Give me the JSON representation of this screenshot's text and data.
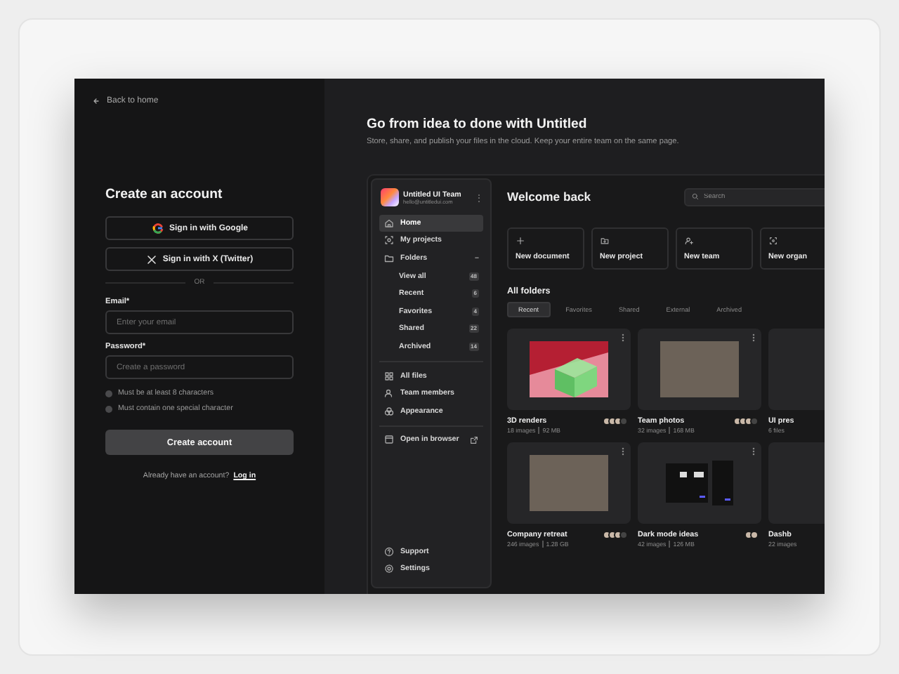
{
  "auth": {
    "back_link": "Back to home",
    "title": "Create an account",
    "social_buttons": [
      {
        "kind": "google",
        "label": "Sign in with Google"
      },
      {
        "kind": "x",
        "label": "Sign in with X (Twitter)"
      }
    ],
    "divider": "OR",
    "fields": [
      {
        "label": "Email*",
        "placeholder": "Enter your email"
      },
      {
        "label": "Password*",
        "placeholder": "Create a password"
      }
    ],
    "password_rules": [
      {
        "text": "Must be at least 8 characters",
        "checked": false
      },
      {
        "text": "Must contain one special character",
        "checked": false
      }
    ],
    "submit": "Create account",
    "footer": "Already have an account?",
    "login_link": "Log in"
  },
  "promo": {
    "title": "Go from idea to done with Untitled",
    "subtitle": "Store, share, and publish your files in the cloud. Keep your entire team on the same page."
  },
  "sidebar": {
    "team_name": "Untitled UI Team",
    "team_email": "hello@untitledui.com",
    "menu": "⋮",
    "groups": [
      [
        {
          "kind": "home",
          "label": "Home",
          "selected": true
        },
        {
          "kind": "projects",
          "label": "My projects",
          "selected": false
        },
        {
          "kind": "folder",
          "label": "Folders",
          "selected": false,
          "expanded": true,
          "toggle": "–",
          "children": [
            {
              "label": "View all",
              "count": "48",
              "selected": false
            },
            {
              "label": "Recent",
              "count": "6",
              "selected": false
            },
            {
              "label": "Favorites",
              "count": "4",
              "selected": false
            },
            {
              "label": "Shared",
              "count": "22",
              "selected": false
            },
            {
              "label": "Archived",
              "count": "14",
              "selected": false
            }
          ]
        }
      ],
      [
        {
          "kind": "grid",
          "label": "All files",
          "selected": false
        },
        {
          "kind": "users",
          "label": "Team members",
          "selected": false
        },
        {
          "kind": "palette",
          "label": "Appearance",
          "selected": false
        }
      ],
      [
        {
          "kind": "browser",
          "label": "Open in browser",
          "selected": false,
          "external": true
        }
      ]
    ],
    "footer_items": [
      {
        "kind": "help",
        "label": "Support",
        "selected": false
      },
      {
        "kind": "gear",
        "label": "Settings",
        "selected": false
      }
    ]
  },
  "main": {
    "title": "Welcome back",
    "search": {
      "placeholder": "Search"
    },
    "quick_actions": [
      {
        "kind": "plus",
        "label": "New document"
      },
      {
        "kind": "folder-plus",
        "label": "New project"
      },
      {
        "kind": "user-plus",
        "label": "New team"
      },
      {
        "kind": "scan",
        "label": "New organ"
      }
    ],
    "section_title": "All folders",
    "tabs": [
      {
        "label": "Recent",
        "selected": true
      },
      {
        "label": "Favorites",
        "selected": false
      },
      {
        "label": "Shared",
        "selected": false
      },
      {
        "label": "External",
        "selected": false
      },
      {
        "label": "Archived",
        "selected": false
      }
    ],
    "folders": [
      {
        "kind": "render",
        "name": "3D renders",
        "meta": [
          "18 images",
          "92 MB"
        ],
        "avatars": [
          {
            "kind": "person"
          },
          {
            "kind": "person"
          },
          {
            "kind": "person"
          },
          {
            "kind": "more"
          }
        ]
      },
      {
        "kind": "photo",
        "name": "Team photos",
        "meta": [
          "32 images",
          "168 MB"
        ],
        "avatars": [
          {
            "kind": "person"
          },
          {
            "kind": "person"
          },
          {
            "kind": "person"
          },
          {
            "kind": "more"
          }
        ]
      },
      {
        "kind": "cut",
        "name": "UI pres",
        "meta": [
          "6 files"
        ]
      },
      {
        "kind": "photo",
        "name": "Company retreat",
        "meta": [
          "246 images",
          "1.28 GB"
        ],
        "avatars": [
          {
            "kind": "person"
          },
          {
            "kind": "person"
          },
          {
            "kind": "person"
          },
          {
            "kind": "more"
          }
        ]
      },
      {
        "kind": "screens",
        "name": "Dark mode ideas",
        "meta": [
          "42 images",
          "126 MB"
        ],
        "avatars": [
          {
            "kind": "person"
          },
          {
            "kind": "person"
          }
        ]
      },
      {
        "kind": "cut",
        "name": "Dashb",
        "meta": [
          "22 images"
        ]
      }
    ]
  }
}
